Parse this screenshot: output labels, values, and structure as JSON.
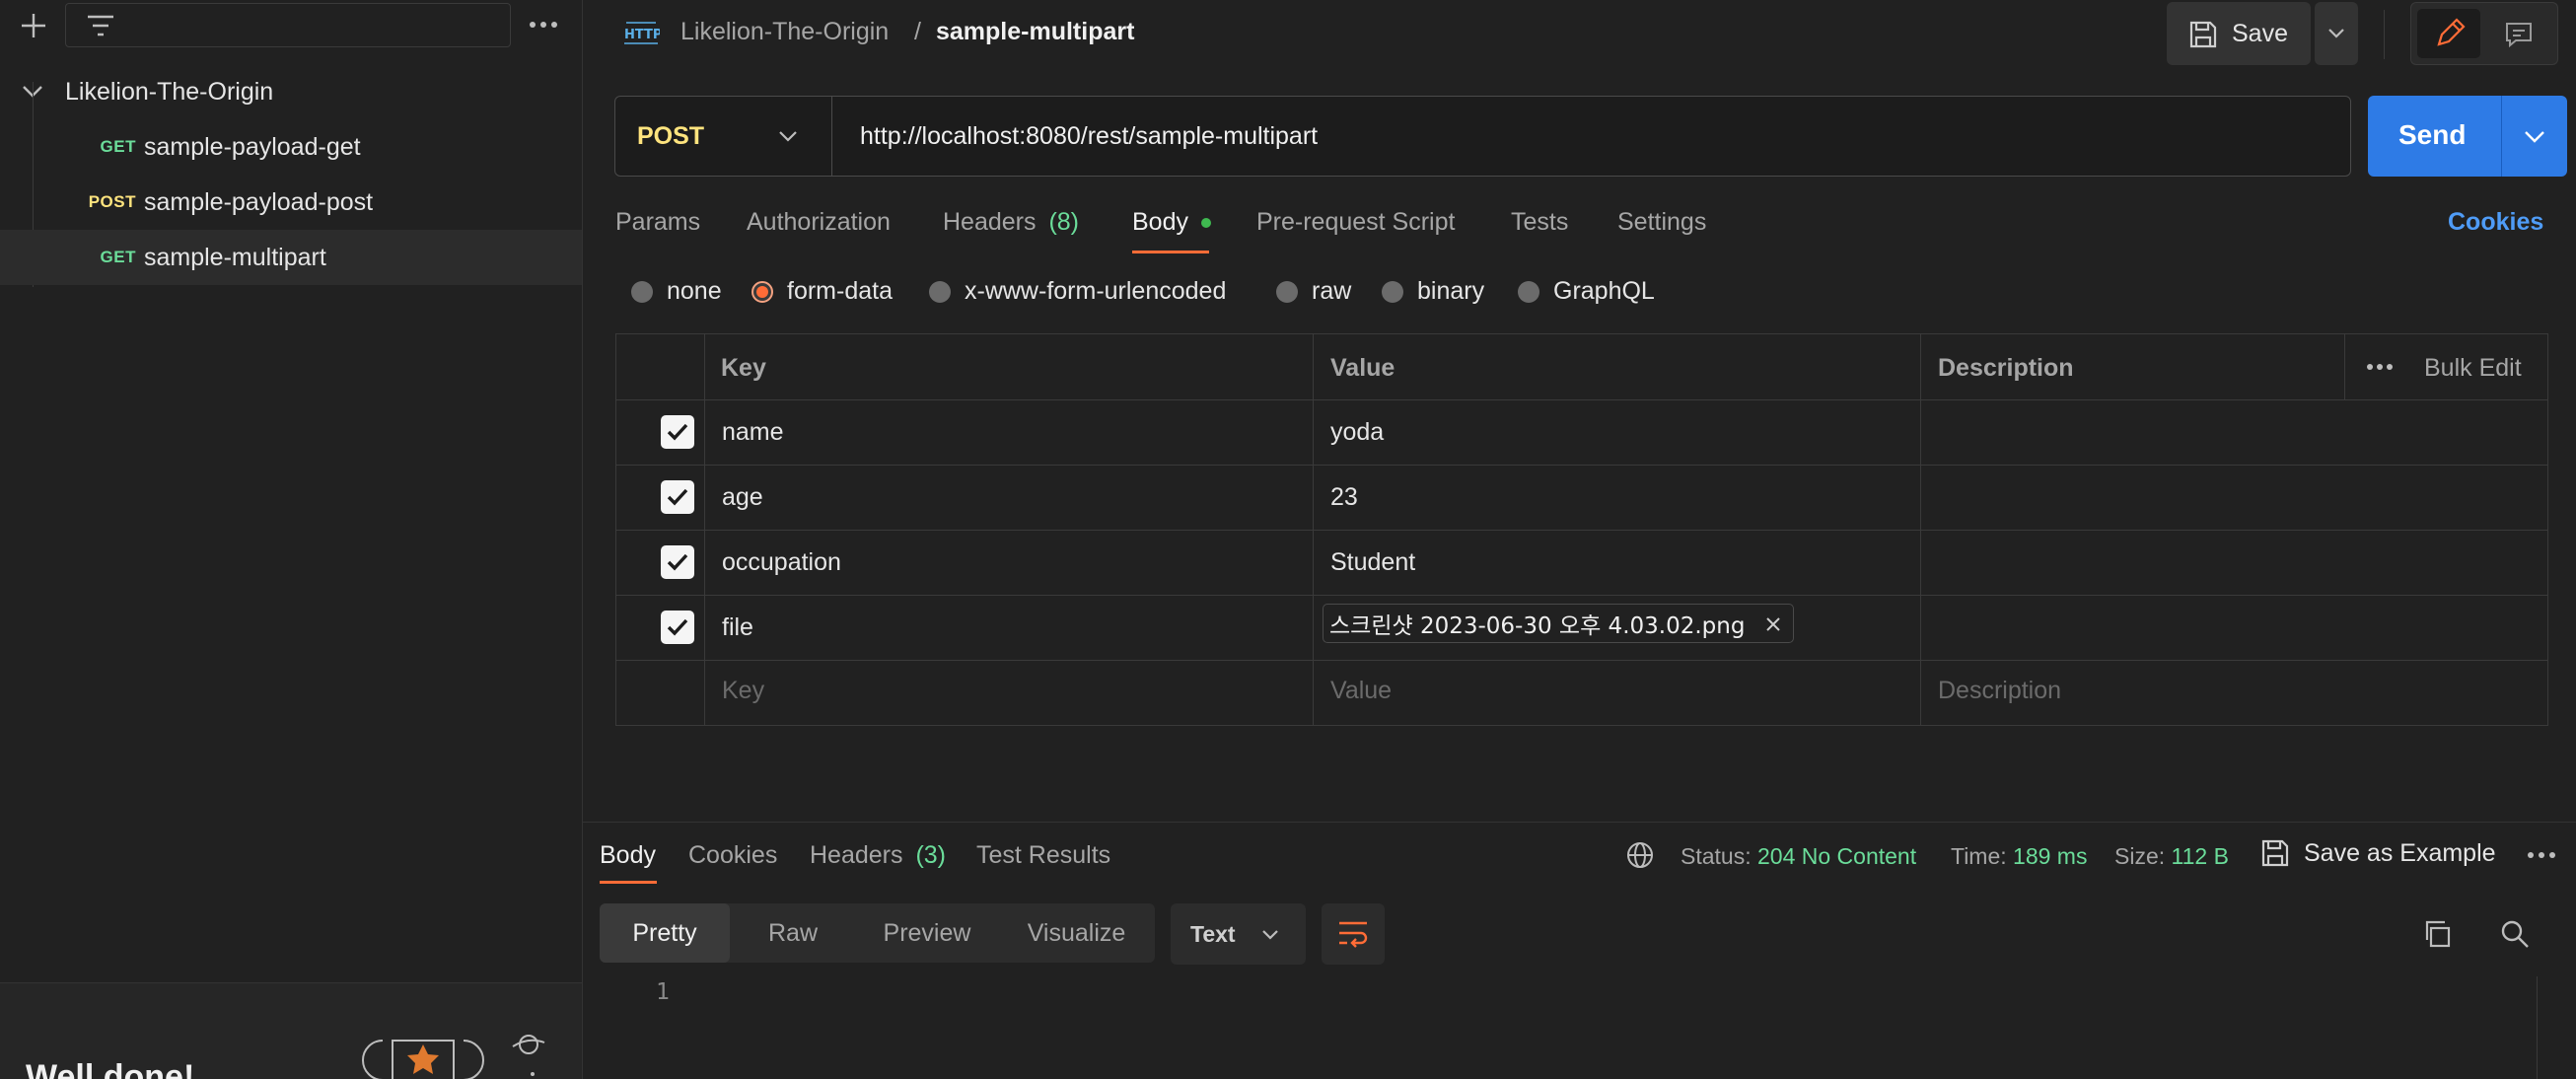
{
  "sidebar": {
    "collection": "Likelion-The-Origin",
    "requests": [
      {
        "method": "GET",
        "name": "sample-payload-get"
      },
      {
        "method": "POST",
        "name": "sample-payload-post"
      },
      {
        "method": "GET",
        "name": "sample-multipart"
      }
    ],
    "promo_text": "Well done!"
  },
  "header": {
    "breadcrumb_parent": "Likelion-The-Origin",
    "breadcrumb_sep": "/",
    "request_name": "sample-multipart",
    "save_label": "Save"
  },
  "request": {
    "method": "POST",
    "url": "http://localhost:8080/rest/sample-multipart",
    "send_label": "Send",
    "tabs": {
      "params": "Params",
      "authorization": "Authorization",
      "headers": "Headers",
      "headers_count": "(8)",
      "body": "Body",
      "prerequest": "Pre-request Script",
      "tests": "Tests",
      "settings": "Settings",
      "cookies": "Cookies"
    },
    "body_types": [
      "none",
      "form-data",
      "x-www-form-urlencoded",
      "raw",
      "binary",
      "GraphQL"
    ],
    "selected_body_type": "form-data"
  },
  "form_table": {
    "headers": {
      "key": "Key",
      "value": "Value",
      "description": "Description",
      "bulk_edit": "Bulk Edit"
    },
    "rows": [
      {
        "key": "name",
        "value": "yoda",
        "checked": true
      },
      {
        "key": "age",
        "value": "23",
        "checked": true
      },
      {
        "key": "occupation",
        "value": "Student",
        "checked": true
      },
      {
        "key": "file",
        "value": "스크린샷 2023-06-30 오후 4.03.02.png",
        "checked": true
      }
    ],
    "placeholders": {
      "key": "Key",
      "value": "Value",
      "description": "Description"
    }
  },
  "response": {
    "tabs": {
      "body": "Body",
      "cookies": "Cookies",
      "headers": "Headers",
      "headers_count": "(3)",
      "test_results": "Test Results"
    },
    "status_label": "Status:",
    "status_code": "204",
    "status_text": "No Content",
    "time_label": "Time:",
    "time_value": "189 ms",
    "size_label": "Size:",
    "size_value": "112 B",
    "save_example": "Save as Example",
    "views": [
      "Pretty",
      "Raw",
      "Preview",
      "Visualize"
    ],
    "format": "Text",
    "line_number": "1"
  },
  "colors": {
    "accent": "#ff6c37",
    "send": "#2e7be6",
    "get": "#6bdd9a",
    "post": "#ffe47e",
    "status_ok": "#6bdd9a",
    "link": "#4f9cf7"
  }
}
